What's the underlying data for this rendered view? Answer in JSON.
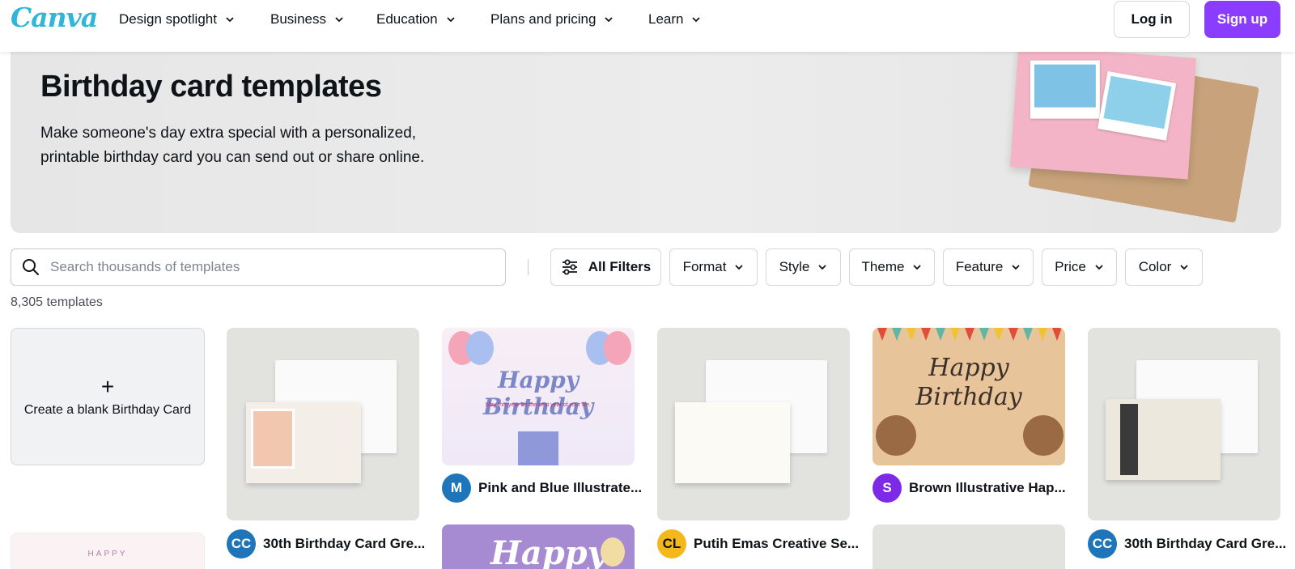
{
  "header": {
    "logo": "Canva",
    "nav": [
      {
        "label": "Design spotlight"
      },
      {
        "label": "Business"
      },
      {
        "label": "Education"
      },
      {
        "label": "Plans and pricing"
      },
      {
        "label": "Learn"
      }
    ],
    "login": "Log in",
    "signup": "Sign up"
  },
  "hero": {
    "title": "Birthday card templates",
    "description": "Make someone's day extra special with a personalized, printable birthday card you can send out or share online."
  },
  "search": {
    "placeholder": "Search thousands of templates"
  },
  "filters": {
    "all": "All Filters",
    "items": [
      "Format",
      "Style",
      "Theme",
      "Feature",
      "Price",
      "Color"
    ]
  },
  "results": {
    "count": "8,305 templates"
  },
  "blank_card": {
    "plus": "+",
    "label": "Create a blank Birthday Card"
  },
  "templates": [
    {
      "name": "30th Birthday Card Gre...",
      "avatar": "CC",
      "avatar_color": "#1f75b9"
    },
    {
      "name": "Pink and Blue Illustrate...",
      "avatar": "M",
      "avatar_color": "#1f75b9",
      "art_title": "Happy Birthday",
      "art_sub": "May this year be the best year of your life."
    },
    {
      "name": "Putih Emas Creative Se...",
      "avatar": "CL",
      "avatar_color": "#f5b81c"
    },
    {
      "name": "Brown Illustrative Hap...",
      "avatar": "S",
      "avatar_color": "#7d2ae8",
      "art_title": "Happy Birthday"
    },
    {
      "name": "30th Birthday Card Gre...",
      "avatar": "CC",
      "avatar_color": "#1f75b9"
    }
  ],
  "bottom_row": {
    "purple_title": "Happy",
    "lilac_title": "HAPPY"
  },
  "colors": {
    "brand_purple": "#8b3dff",
    "logo": "#2fb6d8"
  }
}
